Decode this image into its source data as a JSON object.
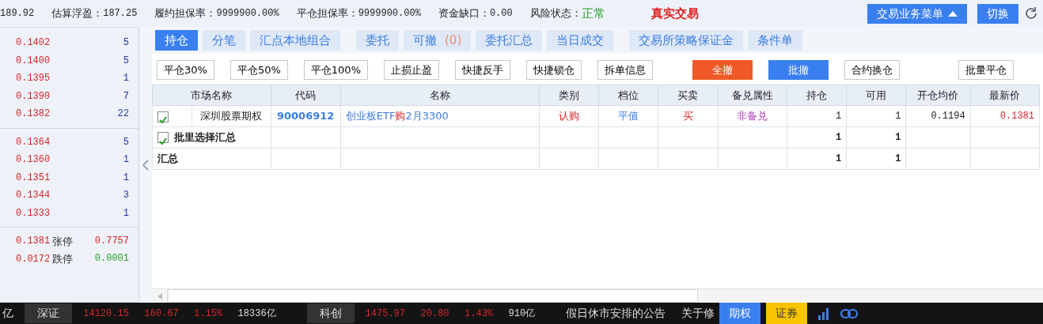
{
  "top_bar": {
    "items": [
      {
        "value": "189.92",
        "kind": "plain"
      },
      {
        "label": "估算浮盈：",
        "value": "187.25",
        "kind": "plain"
      },
      {
        "label": "履约担保率：",
        "value": "9999900.00%",
        "kind": "plain"
      },
      {
        "label": "平仓担保率：",
        "value": "9999900.00%",
        "kind": "plain"
      },
      {
        "label": "资金缺口：",
        "value": "0.00",
        "kind": "plain"
      },
      {
        "label": "风险状态：",
        "value": "正常",
        "kind": "good"
      }
    ],
    "mode": "真实交易",
    "menu_button": "交易业务菜单",
    "switch_button": "切换"
  },
  "quote_panel": {
    "asks": [
      {
        "price": "0.1402",
        "volume": "5"
      },
      {
        "price": "0.1400",
        "volume": "5"
      },
      {
        "price": "0.1395",
        "volume": "1"
      },
      {
        "price": "0.1390",
        "volume": "7"
      },
      {
        "price": "0.1382",
        "volume": "22"
      }
    ],
    "bids": [
      {
        "price": "0.1364",
        "volume": "5"
      },
      {
        "price": "0.1360",
        "volume": "1"
      },
      {
        "price": "0.1351",
        "volume": "1"
      },
      {
        "price": "0.1344",
        "volume": "3"
      },
      {
        "price": "0.1333",
        "volume": "1"
      }
    ],
    "prices": [
      {
        "value": "0.1381"
      },
      {
        "value": "0.0172"
      }
    ],
    "limits": [
      {
        "label": "张停",
        "value": "0.7757",
        "kind": "up"
      },
      {
        "label": "跌停",
        "value": "0.0001",
        "kind": "down"
      }
    ]
  },
  "tabs": [
    {
      "label": "持仓",
      "selected": true
    },
    {
      "label": "分笔",
      "selected": false
    },
    {
      "label": "汇点本地组合",
      "selected": false
    },
    {
      "label": "委托",
      "selected": false
    },
    {
      "label": "可撤",
      "count": "(0)",
      "selected": false
    },
    {
      "label": "委托汇总",
      "selected": false
    },
    {
      "label": "当日成交",
      "selected": false
    },
    {
      "label": "交易所策略保证金",
      "selected": false
    },
    {
      "label": "条件单",
      "selected": false
    }
  ],
  "actions": [
    {
      "label": "平仓30%",
      "kind": "plain"
    },
    {
      "label": "平仓50%",
      "kind": "plain"
    },
    {
      "label": "平仓100%",
      "kind": "plain"
    },
    {
      "label": "止损止盈",
      "kind": "plain"
    },
    {
      "label": "快捷反手",
      "kind": "plain"
    },
    {
      "label": "快捷锁仓",
      "kind": "plain"
    },
    {
      "label": "拆单信息",
      "kind": "plain"
    },
    {
      "label": "全撤",
      "kind": "danger"
    },
    {
      "label": "批撤",
      "kind": "primary"
    },
    {
      "label": "合约换仓",
      "kind": "plain"
    },
    {
      "label": "批量平仓",
      "kind": "plain"
    }
  ],
  "table": {
    "columns": [
      "市场名称",
      "代码",
      "名称",
      "类别",
      "档位",
      "买卖",
      "备兑属性",
      "持仓",
      "可用",
      "开仓均价",
      "最新价"
    ],
    "rows": [
      {
        "kind": "position",
        "checked": true,
        "market": "深圳股票期权",
        "code": "90006912",
        "name": {
          "before": "创业板ETF",
          "highlight": "购",
          "after": "2月3300"
        },
        "category": "认购",
        "level": "平值",
        "side": "买",
        "cover": "非备兑",
        "hold": "1",
        "available": "1",
        "avg_price": "0.1194",
        "last_price": "0.1381"
      },
      {
        "kind": "selected_total",
        "checked": true,
        "label": "批里选择汇总",
        "hold": "1",
        "available": "1"
      },
      {
        "kind": "total",
        "label": "汇总",
        "hold": "1",
        "available": "1"
      }
    ]
  },
  "ticker": {
    "lead": "亿",
    "markets": [
      {
        "name": "深证",
        "index": "14120.15",
        "change": "160.67",
        "percent": "1.15%",
        "amount": "18336亿"
      },
      {
        "name": "科创",
        "index": "1475.97",
        "change": "20.80",
        "percent": "1.43%",
        "amount": "910亿"
      }
    ],
    "notices": [
      "假日休市安排的公告",
      "关于修"
    ],
    "tabs": [
      {
        "label": "期权",
        "kind": "options"
      },
      {
        "label": "证券",
        "kind": "securities"
      }
    ]
  }
}
